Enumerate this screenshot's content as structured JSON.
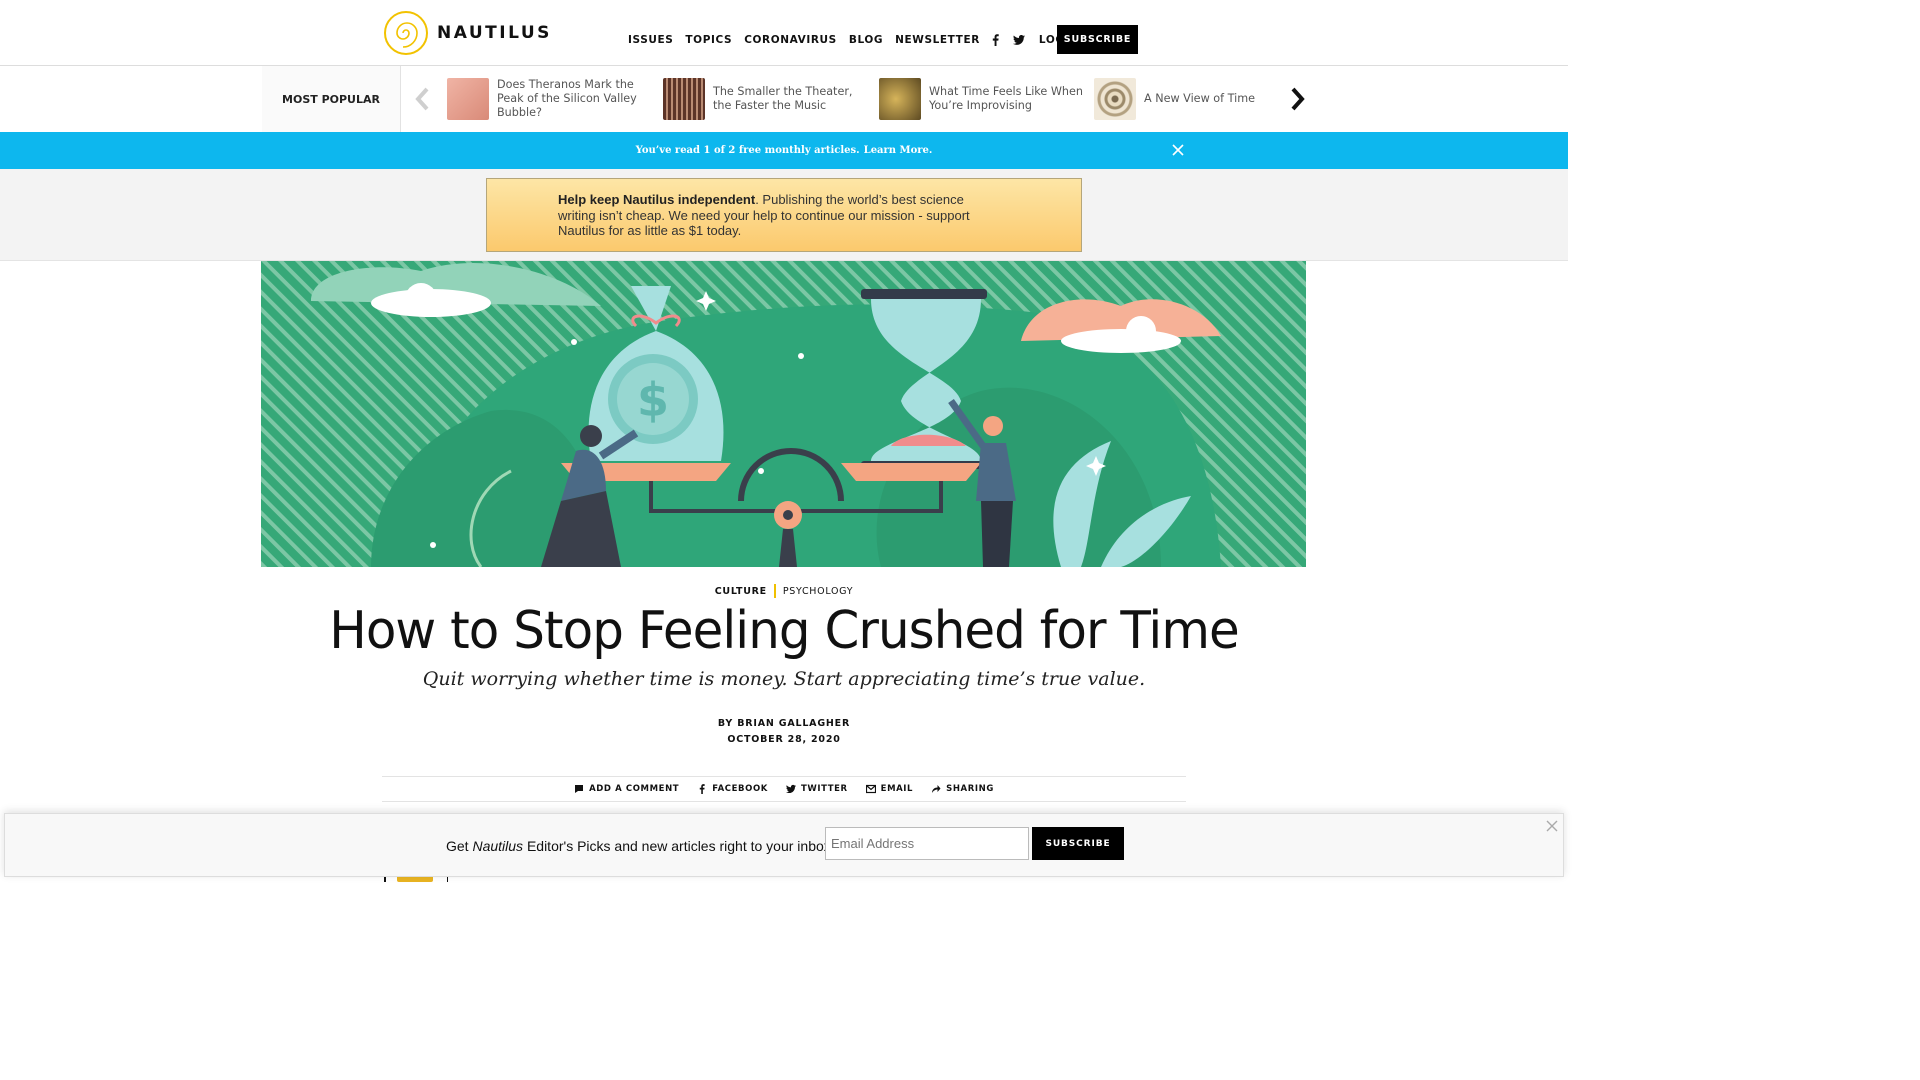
{
  "header": {
    "logo_text": "NAUTILUS",
    "nav": [
      "ISSUES",
      "TOPICS",
      "CORONAVIRUS",
      "BLOG",
      "NEWSLETTER"
    ],
    "login_label": "LOGIN",
    "subscribe_label": "SUBSCRIBE"
  },
  "most_popular": {
    "label": "MOST POPULAR",
    "items": [
      {
        "title": "Does Theranos Mark the Peak of the Silicon Valley Bubble?",
        "thumb_color": "#e8a292"
      },
      {
        "title": "The Smaller the Theater, the Faster the Music",
        "thumb_color": "#7a4a3a"
      },
      {
        "title": "What Time Feels Like When You’re Improvising",
        "thumb_color": "#8a7236"
      },
      {
        "title": "A New View of Time",
        "thumb_color": "#c9b99a"
      }
    ]
  },
  "infobar": {
    "text": "You’ve read 1 of 2 free monthly articles.",
    "link": "Learn More."
  },
  "donate": {
    "bold": "Help keep Nautilus independent",
    "text": ". Publishing the world’s best science writing isn’t cheap. We need your help to continue our mission - support Nautilus for as little as $1 today."
  },
  "article": {
    "category_primary": "CULTURE",
    "category_secondary": "PSYCHOLOGY",
    "title": "How to Stop Feeling Crushed for Time",
    "subtitle": "Quit worrying whether time is money. Start appreciating time’s true value.",
    "byline": "BY BRIAN GALLAGHER",
    "date": "OCTOBER 28, 2020"
  },
  "share": {
    "comment": "ADD A COMMENT",
    "facebook": "FACEBOOK",
    "twitter": "TWITTER",
    "email": "EMAIL",
    "sharing": "SHARING"
  },
  "newsletter": {
    "text_pre": "Get ",
    "text_em": "Nautilus",
    "text_post": " Editor's Picks and new articles right to your inbox!",
    "placeholder": "Email Address",
    "button": "SUBSCRIBE"
  },
  "colors": {
    "accent_blue": "#0db7ee",
    "hero_green": "#2fa679",
    "logo_gold": "#f2c200"
  }
}
